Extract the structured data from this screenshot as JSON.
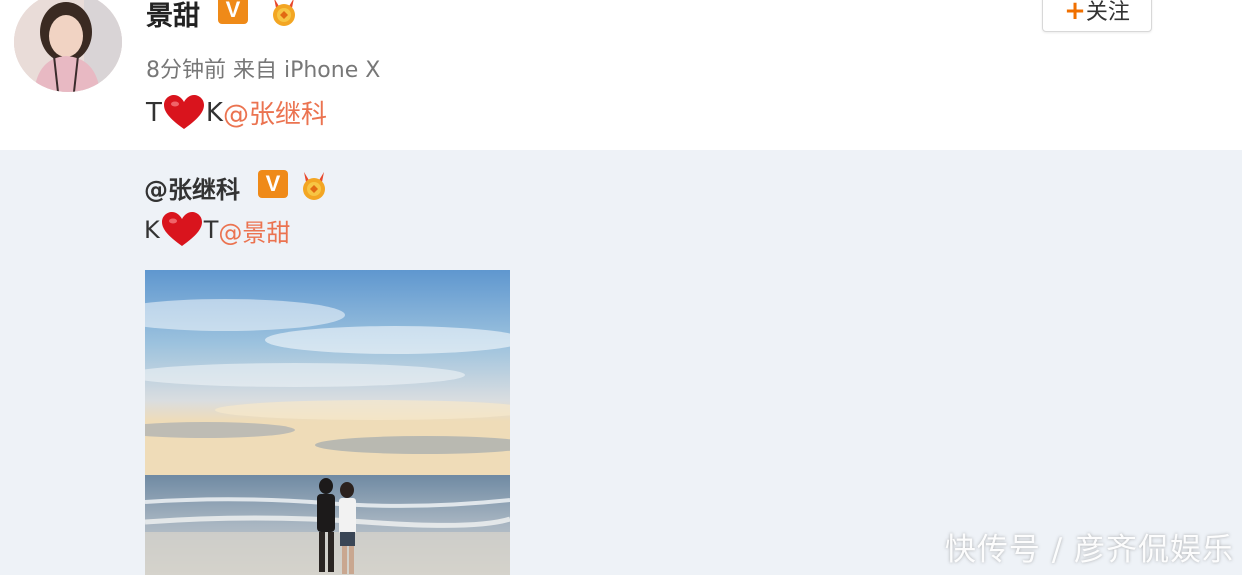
{
  "post": {
    "author": "景甜",
    "meta": "8分钟前 来自 iPhone X",
    "text_prefix": "T",
    "text_suffix": "K",
    "mention": "@张继科",
    "follow_plus": "+",
    "follow_label": "关注"
  },
  "repost": {
    "author": "@张继科",
    "text_prefix": "K",
    "text_suffix": "T",
    "mention": "@景甜"
  },
  "badge_letter": "V",
  "watermark": "快传号 / 彦齐侃娱乐",
  "colors": {
    "mention": "#eb7350",
    "verified_badge": "#ef8a18",
    "repost_bg": "#eef2f7",
    "heart": "#d9141d"
  },
  "icons": [
    "verified-badge-icon",
    "medal-icon",
    "heart-emoji-icon",
    "plus-icon"
  ]
}
